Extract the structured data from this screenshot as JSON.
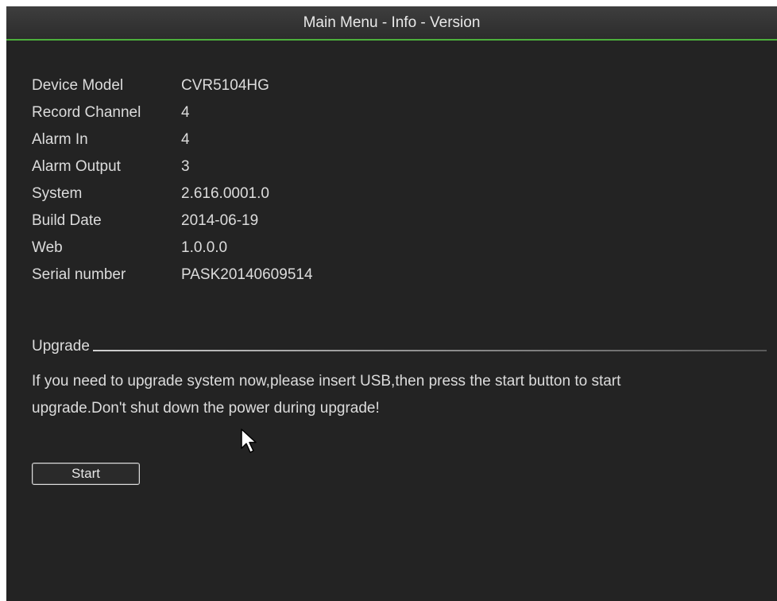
{
  "window": {
    "title": "Main Menu - Info - Version"
  },
  "info": {
    "rows": [
      {
        "label": "Device Model",
        "value": "CVR5104HG"
      },
      {
        "label": "Record Channel",
        "value": "4"
      },
      {
        "label": "Alarm In",
        "value": "4"
      },
      {
        "label": "Alarm Output",
        "value": "3"
      },
      {
        "label": "System",
        "value": "2.616.0001.0"
      },
      {
        "label": "Build Date",
        "value": "2014-06-19"
      },
      {
        "label": "Web",
        "value": "1.0.0.0"
      },
      {
        "label": "Serial number",
        "value": "PASK20140609514"
      }
    ]
  },
  "upgrade": {
    "section_label": "Upgrade",
    "message_line1": "If you need to upgrade system now,please insert USB,then press the start button to start",
    "message_line2": "upgrade.Don't shut down the power during upgrade!",
    "start_label": "Start"
  },
  "colors": {
    "title_accent": "#4caf3c",
    "background": "#232323",
    "text": "#dcdcdc"
  },
  "icons": {
    "cursor": "mouse-pointer-icon"
  }
}
